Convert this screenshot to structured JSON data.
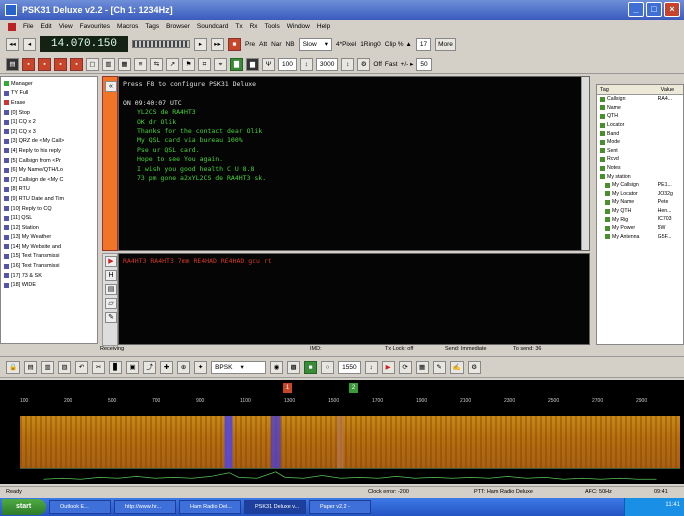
{
  "window": {
    "title": "PSK31 Deluxe v2.2 - [Ch 1: 1234Hz]"
  },
  "menu": [
    "File",
    "Edit",
    "View",
    "Favourites",
    "Macros",
    "Tags",
    "Browser",
    "Soundcard",
    "Tx",
    "Rx",
    "Tools",
    "Window",
    "Help"
  ],
  "toolbar1": {
    "frequency": "14.070.150",
    "pre": "Pre",
    "att": "Att",
    "nar": "Nar",
    "nb": "NB",
    "speed": "Slow",
    "pixel": "4*Pixel",
    "rings": "1Ring0",
    "clip": "Clip % ▲",
    "clip_val": "17",
    "more": "More"
  },
  "toolbar2": {
    "val1": "100",
    "val2": "3000",
    "off": "Off",
    "fast": "Fast",
    "delta": "+/- ▸",
    "val3": "50"
  },
  "macros": [
    "Manager",
    "TY Full",
    "Erase",
    "[0] Stop",
    "[1] CQ x 2",
    "[2] CQ x 3",
    "[3] QRZ de <My Call>",
    "[4] Reply to his reply",
    "[5] Callsign from <Pr",
    "[6] My Name/QTH/Lo",
    "[7] Callsign de <My C",
    "[8] RTU",
    "[9] RTU Date and Tim",
    "[10] Reply to CQ",
    "[11] QSL",
    "[12] Station",
    "[13] My Weather",
    "[14] My Website and",
    "[15] Text Transmissi",
    "[16] Text Transmissi",
    "[17] 73 & SK",
    "[18] WIDE"
  ],
  "tx_lines": [
    {
      "text": "Press F8 to configure PSK31 Deluxe",
      "cls": "h"
    },
    {
      "text": "",
      "cls": ""
    },
    {
      "text": "ON 09:40:07 UTC",
      "cls": "h"
    },
    {
      "text": "YL2CS de RA4HT3",
      "cls": "ind"
    },
    {
      "text": "OK dr Olik",
      "cls": "ind"
    },
    {
      "text": "Thanks for the contact dear Olik",
      "cls": "ind"
    },
    {
      "text": "My QSL card via bureau 100%",
      "cls": "ind"
    },
    {
      "text": "Pse ur QSL card.",
      "cls": "ind"
    },
    {
      "text": "Hope to see You again.",
      "cls": "ind"
    },
    {
      "text": "I wish you good health C U 8.8",
      "cls": "ind"
    },
    {
      "text": "73 pm gone a2xYL2CS de RA4HT3 sk.",
      "cls": "ind"
    }
  ],
  "rx_text": "RA4HT3 RA4HT3 7mm RE4HAD RE4HAD gcu rt",
  "logger": {
    "header": {
      "tag": "Tag",
      "value": "Value"
    },
    "rows": [
      {
        "tag": "Callsign",
        "value": "RA4...",
        "sub": false
      },
      {
        "tag": "Name",
        "value": "",
        "sub": false
      },
      {
        "tag": "QTH",
        "value": "",
        "sub": false
      },
      {
        "tag": "Locator",
        "value": "",
        "sub": false
      },
      {
        "tag": "Band",
        "value": "",
        "sub": false
      },
      {
        "tag": "Mode",
        "value": "",
        "sub": false
      },
      {
        "tag": "Sent",
        "value": "",
        "sub": false
      },
      {
        "tag": "Rcvd",
        "value": "",
        "sub": false
      },
      {
        "tag": "Notes",
        "value": "",
        "sub": false
      },
      {
        "tag": "My station",
        "value": "",
        "sub": false
      },
      {
        "tag": "My Callsign",
        "value": "PE1...",
        "sub": true
      },
      {
        "tag": "My Locator",
        "value": "JO32g",
        "sub": true
      },
      {
        "tag": "My Name",
        "value": "Pete",
        "sub": true
      },
      {
        "tag": "My QTH",
        "value": "Hen...",
        "sub": true
      },
      {
        "tag": "My Rig",
        "value": "IC703",
        "sub": true
      },
      {
        "tag": "My Power",
        "value": "5W",
        "sub": true
      },
      {
        "tag": "My Antenna",
        "value": "G5F...",
        "sub": true
      }
    ]
  },
  "status_mid": {
    "receiving": "Receiving",
    "imd": "IMD:",
    "txlock": "Tx Lock: off",
    "send": "Send: Immediate",
    "tosend": "To send: 36"
  },
  "toolbar3": {
    "mode": "BPSK",
    "freq": "1550"
  },
  "scale_ticks": [
    "100",
    "200",
    "500",
    "700",
    "900",
    "1100",
    "1300",
    "1500",
    "1700",
    "1900",
    "2100",
    "2300",
    "2500",
    "2700",
    "2900"
  ],
  "markers": [
    "1",
    "2"
  ],
  "status_bottom": {
    "ready": "Ready",
    "clock": "Clock error: -200",
    "ptt": "PTT: Ham Radio Deluxe",
    "afc": "AFC: 50Hz",
    "time": "09:41"
  },
  "taskbar": {
    "start": "start",
    "tasks": [
      "Outlook E...",
      "http://www.hr...",
      "Ham Radio Del...",
      "PSK31 Deluxe v...",
      "Paper v2.2 -"
    ],
    "clock": "11:41"
  }
}
